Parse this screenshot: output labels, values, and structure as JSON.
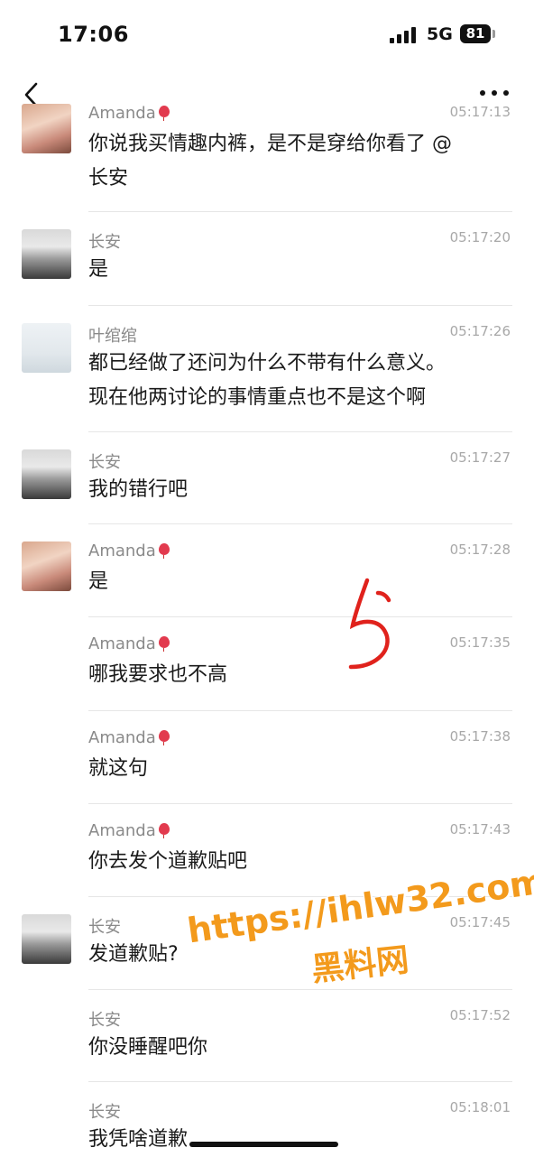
{
  "status_bar": {
    "time": "17:06",
    "network": "5G",
    "battery": "81"
  },
  "messages": [
    {
      "sender": "Amanda",
      "balloon": true,
      "time": "05:17:13",
      "lines": [
        "你说我买情趣内裤，是不是穿给你看了 @",
        "长安"
      ],
      "avatar": "amanda"
    },
    {
      "sender": "长安",
      "balloon": false,
      "time": "05:17:20",
      "lines": [
        "是"
      ],
      "avatar": "changan"
    },
    {
      "sender": "叶绾绾",
      "balloon": false,
      "time": "05:17:26",
      "lines": [
        "都已经做了还问为什么不带有什么意义。",
        "现在他两讨论的事情重点也不是这个啊"
      ],
      "avatar": "ye"
    },
    {
      "sender": "长安",
      "balloon": false,
      "time": "05:17:27",
      "lines": [
        "我的错行吧"
      ],
      "avatar": "changan"
    },
    {
      "sender": "Amanda",
      "balloon": true,
      "time": "05:17:28",
      "lines": [
        "是"
      ],
      "avatar": "amanda"
    },
    {
      "sender": "Amanda",
      "balloon": true,
      "time": "05:17:35",
      "lines": [
        "哪我要求也不高"
      ],
      "avatar": ""
    },
    {
      "sender": "Amanda",
      "balloon": true,
      "time": "05:17:38",
      "lines": [
        "就这句"
      ],
      "avatar": ""
    },
    {
      "sender": "Amanda",
      "balloon": true,
      "time": "05:17:43",
      "lines": [
        "你去发个道歉贴吧"
      ],
      "avatar": ""
    },
    {
      "sender": "长安",
      "balloon": false,
      "time": "05:17:45",
      "lines": [
        "发道歉贴?"
      ],
      "avatar": "changan"
    },
    {
      "sender": "长安",
      "balloon": false,
      "time": "05:17:52",
      "lines": [
        "你没睡醒吧你"
      ],
      "avatar": ""
    },
    {
      "sender": "长安",
      "balloon": false,
      "time": "05:18:01",
      "lines": [
        "我凭啥道歉"
      ],
      "avatar": ""
    }
  ],
  "watermark": {
    "url": "https://ihlw32.com",
    "label": "黑料网"
  },
  "annotation": {
    "mark": "5",
    "color": "#e0221c"
  }
}
